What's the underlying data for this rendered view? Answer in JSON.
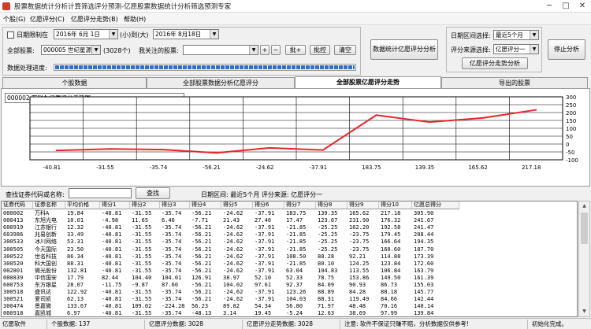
{
  "window": {
    "title": "股票数据统计分析计算筛选评分预测-亿愿股票数据统计分析筛选预测专家",
    "minimize": "─",
    "maximize": "□",
    "close": "✕"
  },
  "menu": [
    "个股(G)",
    "亿愿评分(C)",
    "亿愿评分走势(B)",
    "帮助(H)"
  ],
  "filter": {
    "date_limit_label": "日期限制在",
    "date_from": "2016年 6月 1日",
    "between_label": "(小)到(大)",
    "date_to": "2016年 8月18日",
    "all_stocks_label": "全部股票:",
    "stock_selected": "000005 世纪星源",
    "count": "(3028个)",
    "watch_label": "我关注的股票:",
    "watch_value": "",
    "plus": "+",
    "minus": "−",
    "batch_add": "批+",
    "batch_remove": "批控",
    "clear": "清空",
    "progress_label": "数据处理进度:",
    "progress_fraction": 1.0
  },
  "buttons": {
    "analyze": "数据统计亿愿评分分析",
    "trend": "亿愿评分走势分析",
    "stop": "停止分析",
    "search": "查找"
  },
  "right_panel": {
    "range_label": "日期区间选择:",
    "range_value": "最近5个月",
    "source_label": "评分来源选择:",
    "source_value": "亿愿评分一"
  },
  "tabs": [
    "个股数据",
    "全部股票数据分析亿愿评分",
    "全部股票亿愿评分走势",
    "导出的股票"
  ],
  "active_tab": 2,
  "chart_caption": "000002 万科A   亿愿评分走势图",
  "chart_data": {
    "type": "line",
    "title": "000002 万科A   亿愿评分走势图",
    "categories": [
      "-40.81",
      "-31.55",
      "-35.74",
      "-56.21",
      "-24.62",
      "-37.91",
      "183.75",
      "139.35",
      "165.62",
      "217.18"
    ],
    "values": [
      -40.81,
      -31.55,
      -35.74,
      -56.21,
      -24.62,
      -37.91,
      183.75,
      139.35,
      165.62,
      217.18
    ],
    "yticks": [
      "300",
      "250",
      "200",
      "150",
      "100",
      "50",
      "0",
      "-50",
      "-100"
    ],
    "ylim": [
      -100,
      300
    ],
    "grid": true,
    "line_color": "#e8242a"
  },
  "search": {
    "label": "查找证券代码或名称:",
    "value": "",
    "info": "日期区间: 最近5个月   评分来源: 亿愿评分一"
  },
  "table": {
    "headers": [
      "证券代码",
      "证券名称",
      "平均价格",
      "得分1",
      "得分2",
      "得分3",
      "得分4",
      "得分5",
      "得分6",
      "得分7",
      "得分8",
      "得分9",
      "得分10",
      "亿愿总得分"
    ],
    "rows": [
      [
        "000002",
        "万科A",
        "19.84",
        "-40.81",
        "-31.55",
        "-35.74",
        "-56.21",
        "-24.62",
        "-37.91",
        "183.75",
        "139.35",
        "165.62",
        "217.18",
        "305.90"
      ],
      [
        "000413",
        "东旭光电",
        "10.01",
        "-4.98",
        "11.65",
        "6.46",
        "-7.71",
        "21.43",
        "27.46",
        "17.47",
        "123.67",
        "231.90",
        "176.32",
        "241.67"
      ],
      [
        "600919",
        "江苏银行",
        "12.32",
        "-40.81",
        "-31.55",
        "-35.74",
        "-56.21",
        "-24.62",
        "-37.91",
        "-21.85",
        "-25.25",
        "162.20",
        "192.58",
        "241.47"
      ],
      [
        "603986",
        "兆易创新",
        "33.49",
        "-40.81",
        "-31.55",
        "-35.74",
        "-56.21",
        "-24.62",
        "-37.91",
        "-21.85",
        "-25.25",
        "-23.75",
        "179.45",
        "208.44"
      ],
      [
        "300533",
        "冰川网络",
        "53.31",
        "-40.81",
        "-31.55",
        "-35.74",
        "-56.21",
        "-24.62",
        "-37.91",
        "-21.85",
        "-25.25",
        "-23.75",
        "166.64",
        "194.35"
      ],
      [
        "300505",
        "今天国际",
        "23.50",
        "-40.81",
        "-31.55",
        "-35.74",
        "-56.21",
        "-24.62",
        "-37.91",
        "-21.85",
        "-25.25",
        "-23.75",
        "160.60",
        "187.70"
      ],
      [
        "300522",
        "世名科技",
        "86.34",
        "-40.81",
        "-31.55",
        "-35.74",
        "-56.21",
        "-24.62",
        "-37.91",
        "108.50",
        "88.28",
        "92.21",
        "114.88",
        "173.39"
      ],
      [
        "300520",
        "科大国创",
        "88.31",
        "-40.81",
        "-31.55",
        "-35.74",
        "-56.21",
        "-24.62",
        "-37.91",
        "-21.85",
        "80.10",
        "124.25",
        "123.84",
        "172.60"
      ],
      [
        "002801",
        "微光股份",
        "132.81",
        "-40.81",
        "-31.55",
        "-35.74",
        "-56.21",
        "-24.62",
        "-37.91",
        "63.04",
        "104.83",
        "113.55",
        "106.84",
        "163.79"
      ],
      [
        "000839",
        "中信国安",
        "17.79",
        "82.44",
        "104.40",
        "104.01",
        "126.91",
        "38.97",
        "52.10",
        "52.33",
        "78.75",
        "153.86",
        "149.50",
        "161.39"
      ],
      [
        "600753",
        "东方银星",
        "28.07",
        "-11.75",
        "-9.87",
        "87.60",
        "-56.21",
        "104.02",
        "97.61",
        "92.37",
        "84.09",
        "90.93",
        "86.73",
        "155.03"
      ],
      [
        "300518",
        "盛讯达",
        "122.92",
        "-40.81",
        "-31.55",
        "-35.74",
        "-56.21",
        "-24.62",
        "-37.91",
        "123.26",
        "88.89",
        "84.28",
        "88.18",
        "145.77"
      ],
      [
        "300521",
        "爱司凯",
        "62.13",
        "-40.81",
        "-31.55",
        "-35.74",
        "-56.21",
        "-24.62",
        "-37.91",
        "104.03",
        "88.31",
        "119.49",
        "84.66",
        "142.44"
      ],
      [
        "300474",
        "景嘉微",
        "133.67",
        "-40.81",
        "109.02",
        "-224.28",
        "56.23",
        "89.82",
        "54.34",
        "56.80",
        "71.97",
        "48.48",
        "70.16",
        "140.14"
      ],
      [
        "000918",
        "嘉凯城",
        "6.97",
        "-40.81",
        "-31.55",
        "-35.74",
        "-48.13",
        "3.14",
        "19.45",
        "-5.24",
        "12.63",
        "38.69",
        "97.99",
        "139.84"
      ],
      [
        "300527",
        "华舟应急",
        "15.84",
        "-40.81",
        "-31.55",
        "-35.74",
        "-56.21",
        "-24.62",
        "-37.91",
        "-21.85",
        "-25.25",
        "114.71",
        "132.27",
        "137.32"
      ]
    ]
  },
  "status": {
    "app": "亿愿软件",
    "individual": "个股数据: 137",
    "score_count": "亿愿评分数据: 3028",
    "trend_count": "亿愿评分走势数据: 3028",
    "notice": "注意: 软件不保证只赚不赔，分析数据仅供参考!",
    "init": "初始化完成。"
  }
}
